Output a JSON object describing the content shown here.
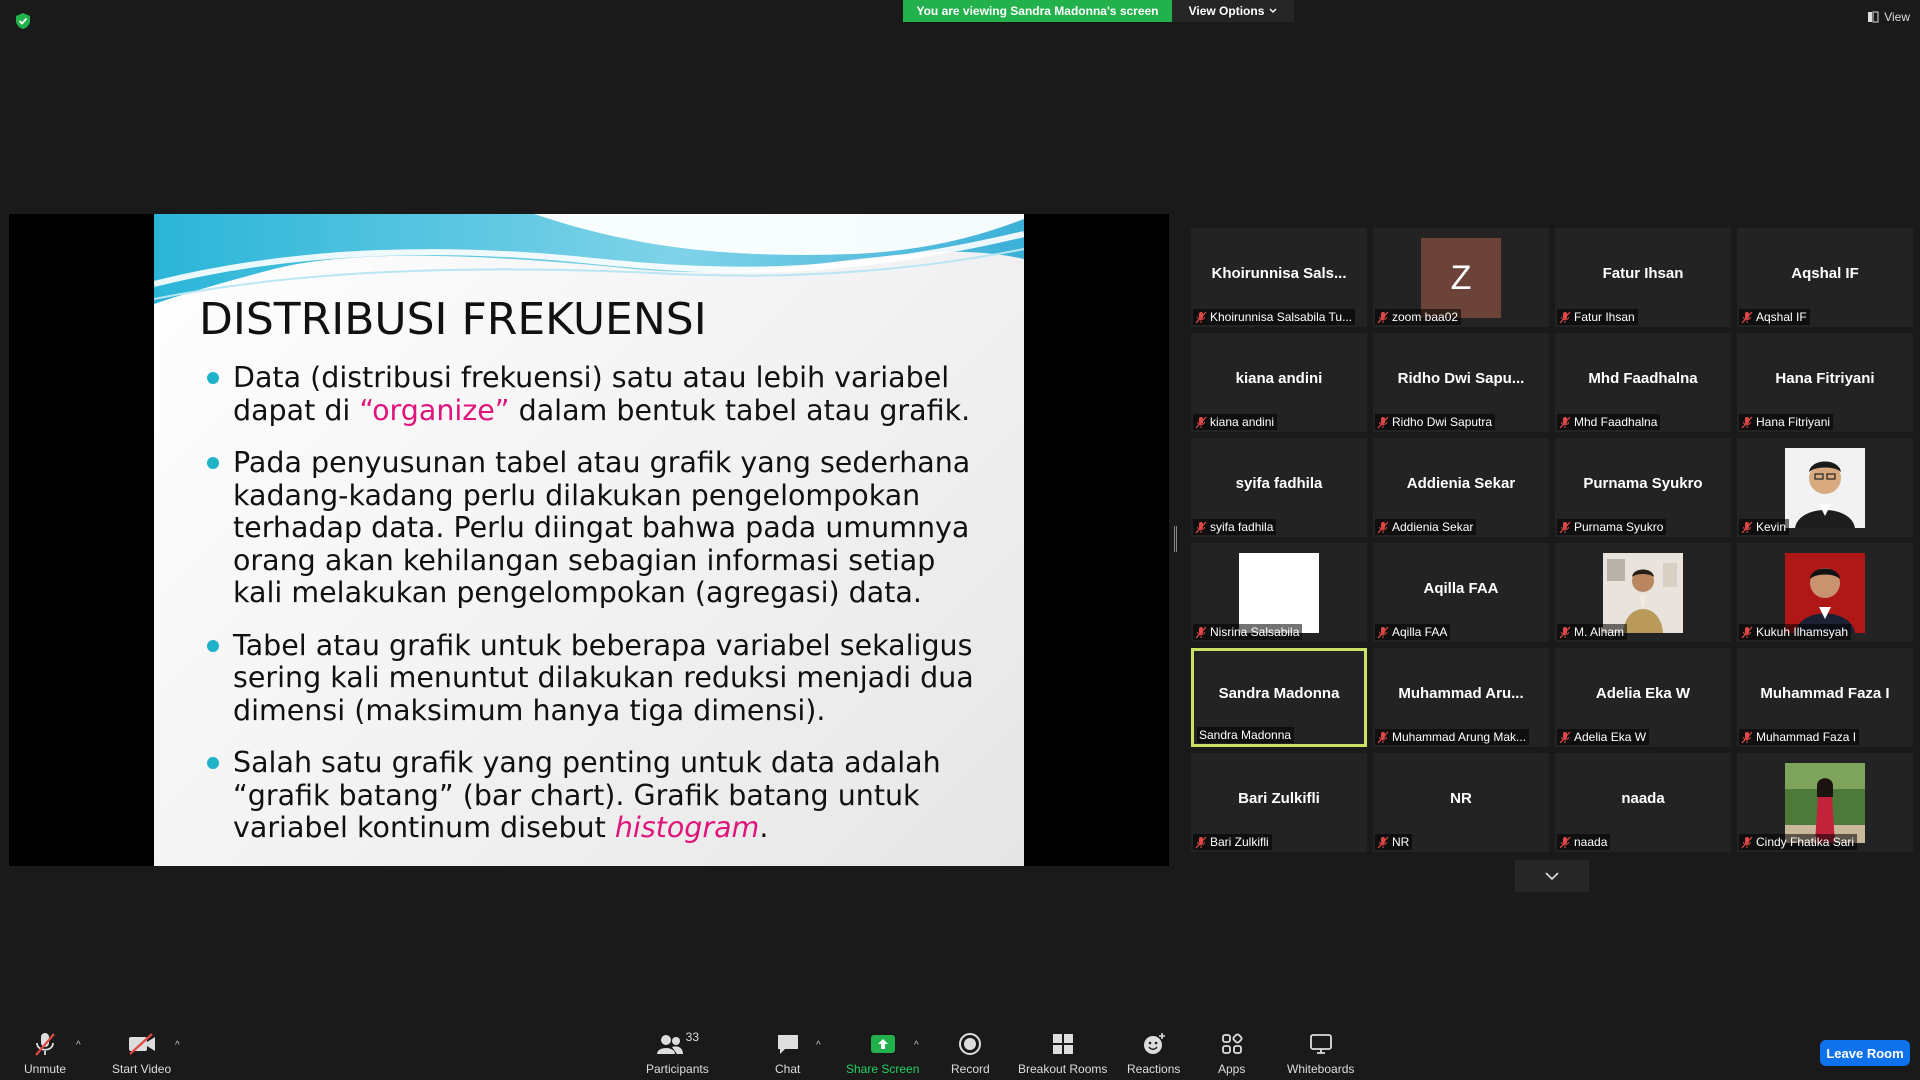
{
  "topbar": {
    "viewing_banner": "You are viewing Sandra Madonna's screen",
    "view_options": "View Options",
    "view": "View"
  },
  "slide": {
    "title": "DISTRIBUSI FREKUENSI",
    "bullet1_a": "Data (distribusi frekuensi) satu atau lebih variabel dapat di ",
    "bullet1_b": "“organize”",
    "bullet1_c": " dalam bentuk tabel atau grafik.",
    "bullet2": "Pada penyusunan tabel atau grafik yang sederhana kadang-kadang perlu dilakukan pengelompokan terhadap data.  Perlu diingat bahwa pada umumnya orang akan kehilangan sebagian informasi setiap kali melakukan pengelompokan (agregasi) data.",
    "bullet3": "Tabel atau grafik untuk beberapa variabel sekaligus sering kali menuntut dilakukan reduksi menjadi dua dimensi (maksimum hanya tiga dimensi).",
    "bullet4_a": "Salah satu grafik yang penting untuk data adalah “grafik batang” (bar chart). Grafik batang untuk variabel kontinum disebut ",
    "bullet4_b": "histogram",
    "bullet4_c": "."
  },
  "gallery": {
    "tiles": [
      {
        "name": "Khoirunnisa  Sals...",
        "label": "Khoirunnisa Salsabila Tu..."
      },
      {
        "letter": "Z",
        "label": "zoom baa02"
      },
      {
        "name": "Fatur Ihsan",
        "label": "Fatur Ihsan"
      },
      {
        "name": "Aqshal IF",
        "label": "Aqshal IF"
      },
      {
        "name": "kiana andini",
        "label": "kiana andini"
      },
      {
        "name": "Ridho  Dwi  Sapu...",
        "label": "Ridho Dwi Saputra"
      },
      {
        "name": "Mhd Faadhalna",
        "label": "Mhd Faadhalna"
      },
      {
        "name": "Hana Fitriyani",
        "label": "Hana Fitriyani"
      },
      {
        "name": "syifa fadhila",
        "label": "syifa fadhila"
      },
      {
        "name": "Addienia Sekar",
        "label": "Addienia Sekar"
      },
      {
        "name": "Purnama Syukro",
        "label": "Purnama Syukro"
      },
      {
        "label": "Kevin"
      },
      {
        "label": "Nisrina Salsabila"
      },
      {
        "name": "Aqilla FAA",
        "label": "Aqilla FAA"
      },
      {
        "label": "M. Alham"
      },
      {
        "label": "Kukuh Ilhamsyah"
      },
      {
        "name": "Sandra Madonna",
        "label": "Sandra Madonna"
      },
      {
        "name": "Muhammad  Aru...",
        "label": "Muhammad Arung Mak..."
      },
      {
        "name": "Adelia Eka W",
        "label": "Adelia Eka W"
      },
      {
        "name": "Muhammad Faza I",
        "label": "Muhammad Faza I"
      },
      {
        "name": "Bari Zulkifli",
        "label": "Bari Zulkifli"
      },
      {
        "name": "NR",
        "label": "NR"
      },
      {
        "name": "naada",
        "label": "naada"
      },
      {
        "label": "Cindy Fhatika Sari"
      }
    ]
  },
  "toolbar": {
    "unmute": "Unmute",
    "start_video": "Start Video",
    "participants": "Participants",
    "participants_count": "33",
    "chat": "Chat",
    "share_screen": "Share Screen",
    "record": "Record",
    "breakout_rooms": "Breakout Rooms",
    "reactions": "Reactions",
    "apps": "Apps",
    "whiteboards": "Whiteboards",
    "leave": "Leave Room"
  },
  "colors": {
    "accent_green": "#23b14d",
    "leave_blue": "#0e72ed",
    "active_border": "#c9e265",
    "slide_pink": "#e0157b",
    "bullet_teal": "#1eb3c9"
  }
}
